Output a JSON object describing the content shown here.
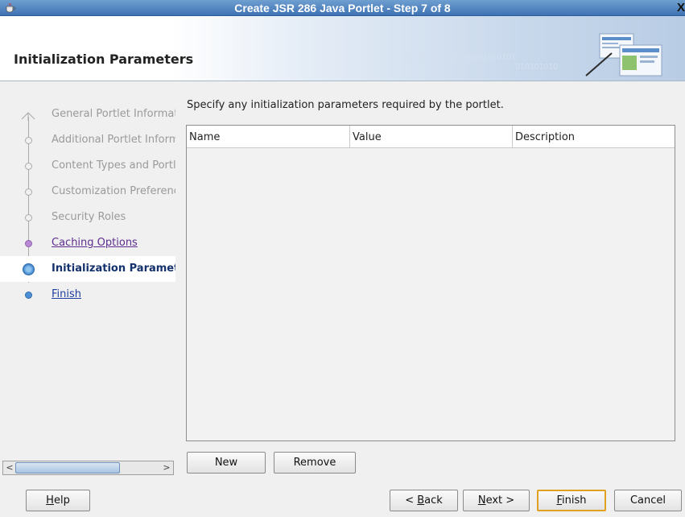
{
  "window": {
    "title": "Create JSR 286 Java Portlet - Step 7 of 8",
    "close_glyph": "X"
  },
  "header": {
    "heading": "Initialization Parameters",
    "binary_text": "010101010101010101010101",
    "binary_text2": "010101010"
  },
  "nav": {
    "steps": [
      {
        "label": "General Portlet Information",
        "state": "disabled"
      },
      {
        "label": "Additional Portlet Information",
        "state": "disabled"
      },
      {
        "label": "Content Types and Portlet Modes",
        "state": "disabled"
      },
      {
        "label": "Customization Preferences",
        "state": "disabled"
      },
      {
        "label": "Security Roles",
        "state": "disabled"
      },
      {
        "label": "Caching Options",
        "state": "visited"
      },
      {
        "label": "Initialization Parameters",
        "state": "current"
      },
      {
        "label": "Finish",
        "state": "link"
      }
    ],
    "scroll_left": "<",
    "scroll_right": ">"
  },
  "main": {
    "instruction": "Specify any initialization parameters required by the portlet.",
    "table": {
      "columns": [
        "Name",
        "Value",
        "Description"
      ],
      "rows": []
    },
    "new_button": "New",
    "remove_button": "Remove"
  },
  "footer": {
    "help": {
      "mnemonic": "H",
      "rest": "elp"
    },
    "back": {
      "prefix": "< ",
      "mnemonic": "B",
      "rest": "ack"
    },
    "next": {
      "mnemonic": "N",
      "rest": "ext >"
    },
    "finish": {
      "mnemonic": "F",
      "rest": "inish"
    },
    "cancel": "Cancel"
  },
  "colors": {
    "title_bar": "#3e72b4",
    "current_step": "#14316e",
    "visited_link": "#5c2d8f",
    "primary_border": "#e0a020"
  }
}
